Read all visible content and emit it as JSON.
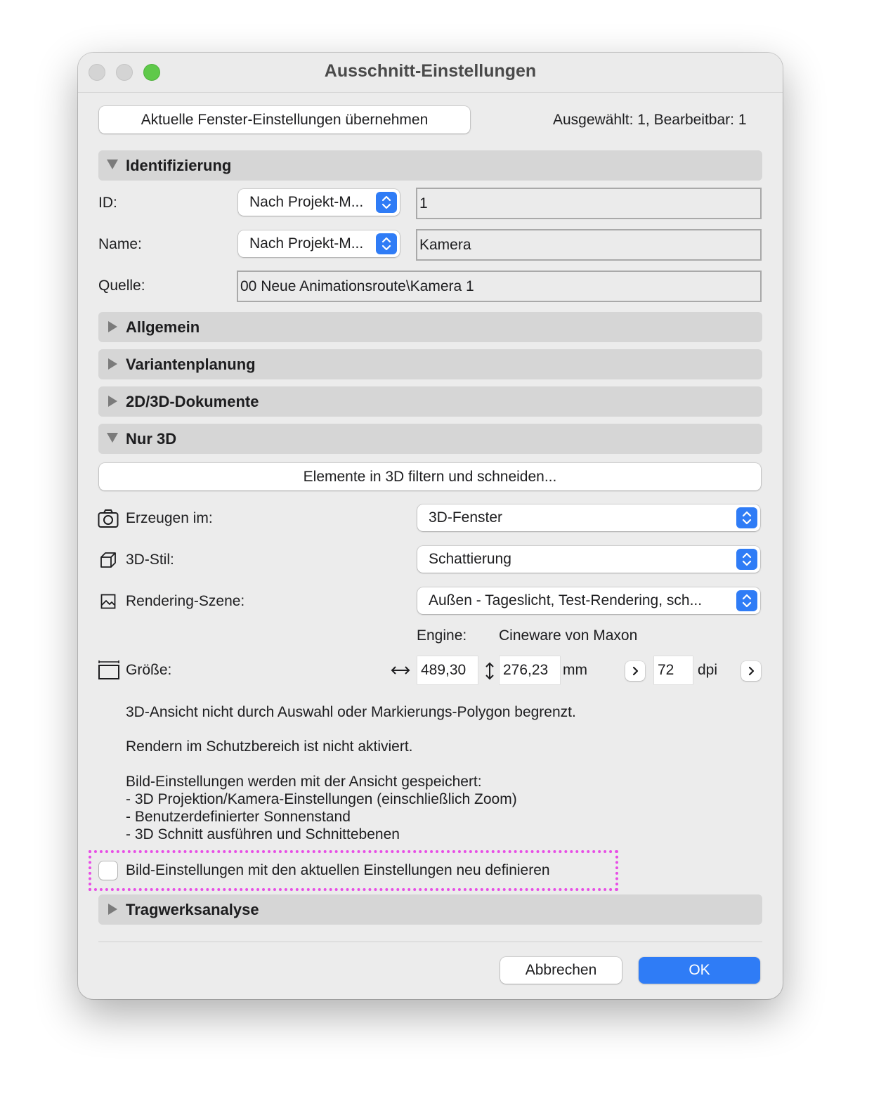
{
  "window": {
    "title": "Ausschnitt-Einstellungen"
  },
  "top": {
    "apply_button": "Aktuelle Fenster-Einstellungen übernehmen",
    "status": "Ausgewählt: 1, Bearbeitbar: 1"
  },
  "identification": {
    "title": "Identifizierung",
    "id_label": "ID:",
    "id_popup": "Nach Projekt-M...",
    "id_value": "1",
    "name_label": "Name:",
    "name_popup": "Nach Projekt-M...",
    "name_value": "Kamera",
    "source_label": "Quelle:",
    "source_value": "00 Neue Animationsroute\\Kamera 1"
  },
  "sections": {
    "allgemein": "Allgemein",
    "variantenplanung": "Variantenplanung",
    "dokumente": "2D/3D-Dokumente",
    "nur3d": "Nur 3D",
    "tragwerk": "Tragwerksanalyse"
  },
  "nur3d": {
    "filter_button": "Elemente in 3D filtern und schneiden...",
    "create_label": "Erzeugen im:",
    "create_value": "3D-Fenster",
    "style_label": "3D-Stil:",
    "style_value": "Schattierung",
    "scene_label": "Rendering-Szene:",
    "scene_value": "Außen - Tageslicht, Test-Rendering, sch...",
    "engine_label": "Engine:",
    "engine_value": "Cineware von Maxon",
    "size_label": "Größe:",
    "width_value": "489,30",
    "height_value": "276,23",
    "unit": "mm",
    "dpi_value": "72",
    "dpi_unit": "dpi",
    "info1": "3D-Ansicht nicht durch Auswahl oder Markierungs-Polygon begrenzt.",
    "info2": "Rendern im Schutzbereich ist nicht aktiviert.",
    "info3_title": "Bild-Einstellungen werden mit der Ansicht gespeichert:",
    "info3_items": [
      "- 3D Projektion/Kamera-Einstellungen (einschließlich Zoom)",
      "- Benutzerdefinierter Sonnenstand",
      "- 3D Schnitt ausführen und Schnittebenen"
    ],
    "redefine_checkbox": "Bild-Einstellungen mit den aktuellen Einstellungen neu definieren"
  },
  "footer": {
    "cancel": "Abbrechen",
    "ok": "OK"
  },
  "colors": {
    "accent": "#2f7cf6",
    "highlight": "#e84ee6"
  }
}
